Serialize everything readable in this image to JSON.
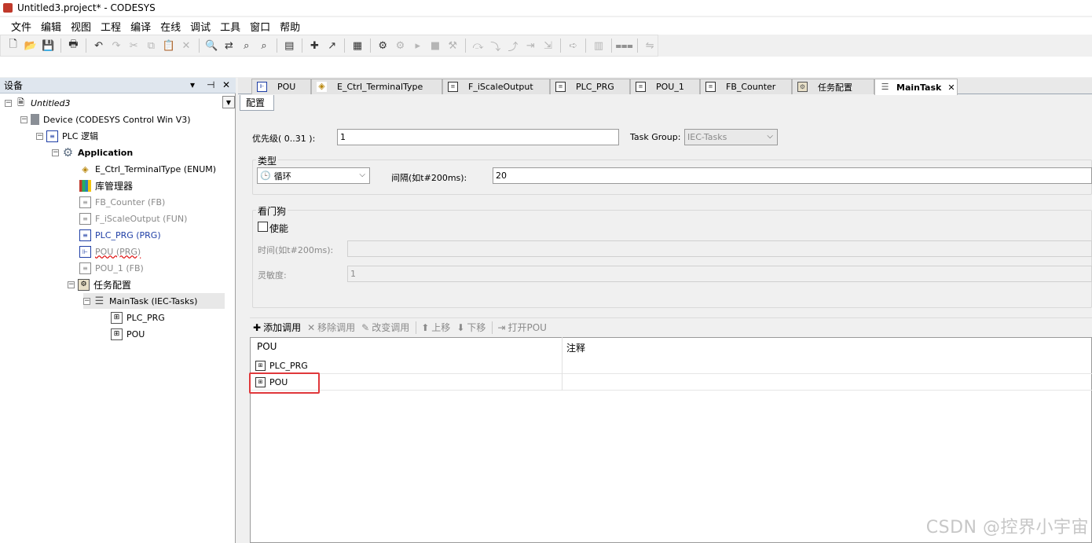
{
  "window": {
    "title": "Untitled3.project* - CODESYS"
  },
  "menu": [
    "文件",
    "编辑",
    "视图",
    "工程",
    "编译",
    "在线",
    "调试",
    "工具",
    "窗口",
    "帮助"
  ],
  "devices_pane": {
    "title": "设备",
    "controls": {
      "dropdown": "▾",
      "pin": "⊣",
      "close": "✕"
    },
    "tree": [
      {
        "label": "Untitled3"
      },
      {
        "label": "Device (CODESYS Control Win V3)"
      },
      {
        "label": "PLC 逻辑"
      },
      {
        "label": "Application"
      },
      {
        "label": "E_Ctrl_TerminalType (ENUM)"
      },
      {
        "label": "库管理器"
      },
      {
        "label": "FB_Counter (FB)"
      },
      {
        "label": "F_iScaleOutput (FUN)"
      },
      {
        "label": "PLC_PRG (PRG)"
      },
      {
        "label": "POU (PRG)"
      },
      {
        "label": "POU_1 (FB)"
      },
      {
        "label": "任务配置"
      },
      {
        "label": "MainTask (IEC-Tasks)"
      },
      {
        "label": "PLC_PRG"
      },
      {
        "label": "POU"
      }
    ]
  },
  "tabs": [
    "POU",
    "E_Ctrl_TerminalType",
    "F_iScaleOutput",
    "PLC_PRG",
    "POU_1",
    "FB_Counter",
    "任务配置",
    "MainTask"
  ],
  "tab_close": "✕",
  "subtab": "配置",
  "task_config": {
    "priority_label": "优先级( 0..31 ):",
    "priority_value": "1",
    "task_group_label": "Task Group:",
    "task_group_value": "IEC-Tasks",
    "type_group_title": "类型",
    "type_value": "循环",
    "interval_label": "间隔(如t#200ms):",
    "interval_value": "20",
    "watchdog_title": "看门狗",
    "enable_label": "使能",
    "enable_checked": false,
    "time_label": "时间(如t#200ms):",
    "time_value": "",
    "sensitivity_label": "灵敏度:",
    "sensitivity_value": "1"
  },
  "calls_toolbar": {
    "add": "添加调用",
    "remove": "移除调用",
    "change": "改变调用",
    "up": "上移",
    "down": "下移",
    "open": "打开POU"
  },
  "calls_table": {
    "columns": [
      "POU",
      "注释"
    ],
    "rows": [
      {
        "pou": "PLC_PRG",
        "comment": ""
      },
      {
        "pou": "POU",
        "comment": ""
      }
    ]
  },
  "watermark": "CSDN @控界小宇宙"
}
